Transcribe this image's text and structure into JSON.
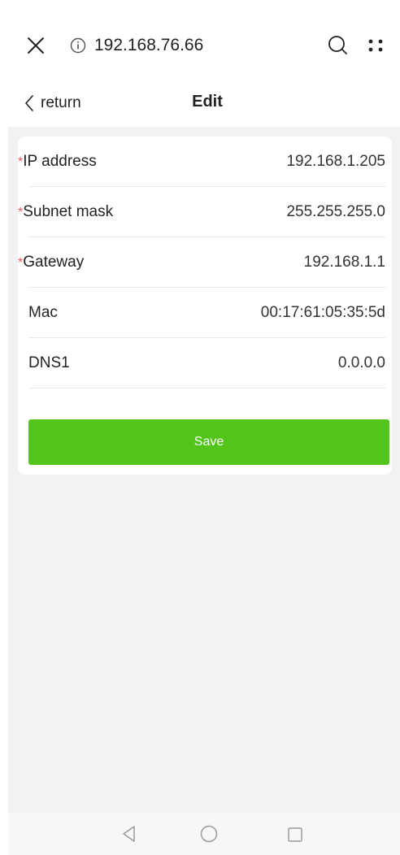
{
  "browser": {
    "url": "192.168.76.66"
  },
  "nav": {
    "back_label": "return",
    "title": "Edit"
  },
  "form": {
    "fields": [
      {
        "label": "IP address",
        "required": true,
        "value": "192.168.1.205"
      },
      {
        "label": "Subnet mask",
        "required": true,
        "value": "255.255.255.0"
      },
      {
        "label": "Gateway",
        "required": true,
        "value": "192.168.1.1"
      },
      {
        "label": "Mac",
        "required": false,
        "value": "00:17:61:05:35:5d"
      },
      {
        "label": "DNS1",
        "required": false,
        "value": "0.0.0.0"
      }
    ],
    "required_marker": "*",
    "save_label": "Save"
  },
  "colors": {
    "accent": "#52c41a",
    "required": "#e05a5a",
    "background": "#f2f2f2"
  },
  "icons": {
    "close": "close-icon",
    "info": "info-icon",
    "search": "search-icon",
    "menu": "dots-menu-icon",
    "back": "chevron-left-icon",
    "sys_back": "triangle-back-icon",
    "sys_home": "circle-home-icon",
    "sys_recent": "square-recent-icon"
  }
}
